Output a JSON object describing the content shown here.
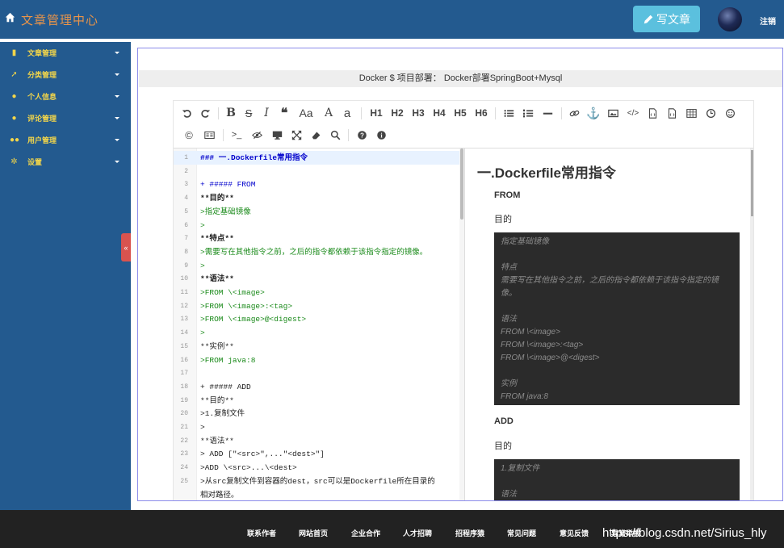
{
  "header": {
    "app_title": "文章管理中心",
    "write_button": "写文章",
    "logout": "注销",
    "icons": {
      "home": "home-icon",
      "write": "pencil-icon",
      "avatar": "user-avatar"
    }
  },
  "sidebar": {
    "items": [
      {
        "label": "文章管理",
        "icon": "book-icon"
      },
      {
        "label": "分类管理",
        "icon": "rocket-icon"
      },
      {
        "label": "个人信息",
        "icon": "user-icon"
      },
      {
        "label": "评论管理",
        "icon": "comments-icon"
      },
      {
        "label": "用户管理",
        "icon": "users-icon"
      },
      {
        "label": "设置",
        "icon": "cogs-icon"
      }
    ],
    "collapse_label": "«"
  },
  "main": {
    "breadcrumb": "Docker $ 项目部署： Docker部署SpringBoot+Mysql"
  },
  "toolbar": {
    "row1": [
      "undo",
      "redo",
      "bold",
      "strikethrough",
      "italic",
      "quote",
      "uppercase",
      "lowercase-a",
      "lowercase",
      "H1",
      "H2",
      "H3",
      "H4",
      "H5",
      "H6",
      "list-ul",
      "list-ol",
      "hr",
      "link",
      "anchor",
      "image",
      "code",
      "preformatted-text",
      "code-block",
      "table",
      "datetime",
      "emoji"
    ],
    "row2": [
      "html-entities",
      "pagebreak",
      "watch",
      "preview",
      "fullscreen",
      "clear",
      "search",
      "help",
      "info"
    ],
    "heading_labels": [
      "H1",
      "H2",
      "H3",
      "H4",
      "H5",
      "H6"
    ],
    "case_labels": [
      "Aa",
      "A",
      "a"
    ]
  },
  "editor": {
    "lines": [
      {
        "n": "1",
        "text": "### 一.Dockerfile常用指令",
        "style": "head"
      },
      {
        "n": "2",
        "text": "",
        "style": "dark"
      },
      {
        "n": "3",
        "text": "+ #####  FROM",
        "style": "blue"
      },
      {
        "n": "4",
        "text": "**目的**",
        "style": "bold"
      },
      {
        "n": "5",
        "text": ">指定基础镜像",
        "style": "green"
      },
      {
        "n": "6",
        "text": ">",
        "style": "green"
      },
      {
        "n": "7",
        "text": "**特点**",
        "style": "bold"
      },
      {
        "n": "8",
        "text": ">需要写在其他指令之前，之后的指令都依赖于该指令指定的镜像。",
        "style": "green"
      },
      {
        "n": "9",
        "text": ">",
        "style": "green"
      },
      {
        "n": "10",
        "text": "**语法**",
        "style": "bold"
      },
      {
        "n": "11",
        "text": ">FROM \\<image>",
        "style": "green"
      },
      {
        "n": "12",
        "text": ">FROM \\<image>:<tag>",
        "style": "green"
      },
      {
        "n": "13",
        "text": ">FROM \\<image>@<digest>",
        "style": "green"
      },
      {
        "n": "14",
        "text": ">",
        "style": "green"
      },
      {
        "n": "15",
        "text": "**实例**",
        "style": "dark"
      },
      {
        "n": "16",
        "text": ">FROM java:8",
        "style": "green"
      },
      {
        "n": "17",
        "text": "",
        "style": "dark"
      },
      {
        "n": "18",
        "text": "+ #####  ADD",
        "style": "dark"
      },
      {
        "n": "19",
        "text": "**目的**",
        "style": "dark"
      },
      {
        "n": "20",
        "text": ">1.复制文件",
        "style": "dark"
      },
      {
        "n": "21",
        "text": ">",
        "style": "dark"
      },
      {
        "n": "22",
        "text": "**语法**",
        "style": "dark"
      },
      {
        "n": "23",
        "text": "> ADD [\"<src>\",...\"<dest>\"]",
        "style": "dark"
      },
      {
        "n": "24",
        "text": ">ADD \\<src>...\\<dest>",
        "style": "dark"
      },
      {
        "n": "25",
        "text": ">从src复制文件到容器的dest，src可以是Dockerfile所在目录的",
        "style": "dark"
      },
      {
        "n": "",
        "text": "相对路径。",
        "style": "dark"
      }
    ]
  },
  "preview": {
    "h1": "一.Dockerfile常用指令",
    "from_heading": "FROM",
    "from_purpose": "目的",
    "from_quote": [
      "指定基础镜像",
      "",
      "特点",
      "需要写在其他指令之前，之后的指令都依赖于该指令指定的镜",
      "像。",
      "",
      "语法",
      "FROM \\<image>",
      "FROM \\<image>:<tag>",
      "FROM \\<image>@<digest>",
      "",
      "实例",
      "FROM java:8"
    ],
    "add_heading": "ADD",
    "add_purpose": "目的",
    "add_quote": [
      "1.复制文件",
      "",
      "语法"
    ]
  },
  "footer": {
    "links": [
      "联系作者",
      "网站首页",
      "企业合作",
      "人才招聘",
      "招程序猿",
      "常见问题",
      "意见反馈",
      "异常举报"
    ],
    "watermark": "https://blog.csdn.net/Sirius_hly"
  }
}
